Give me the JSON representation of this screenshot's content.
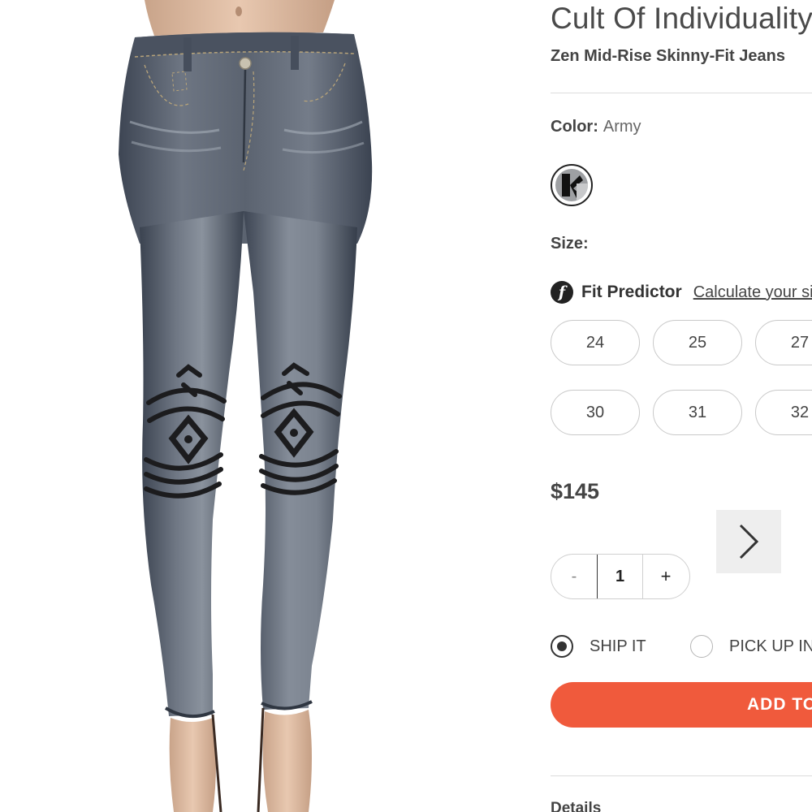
{
  "product": {
    "brand": "Cult Of Individuality",
    "name": "Zen Mid-Rise Skinny-Fit Jeans",
    "image_alt": "Cult Of Individuality Zen Mid-Rise Skinny-Fit Jeans in Army wash"
  },
  "color": {
    "label": "Color:",
    "value": "Army"
  },
  "size": {
    "label": "Size:",
    "fit_predictor_title": "Fit Predictor",
    "fit_predictor_link": "Calculate your size",
    "fit_predictor_logo": "f",
    "options": [
      "24",
      "25",
      "27",
      "30",
      "31",
      "32"
    ]
  },
  "price": "$145",
  "quantity": {
    "minus": "-",
    "value": "1",
    "plus": "+"
  },
  "fulfillment": {
    "ship_label": "SHIP IT",
    "pickup_label": "PICK UP IN STORE",
    "selected": "ship"
  },
  "add_button_label": "ADD TO BAG",
  "details_label": "Details",
  "colors": {
    "accent": "#f05a3c",
    "text": "#444444",
    "border": "#c9c9c9"
  }
}
